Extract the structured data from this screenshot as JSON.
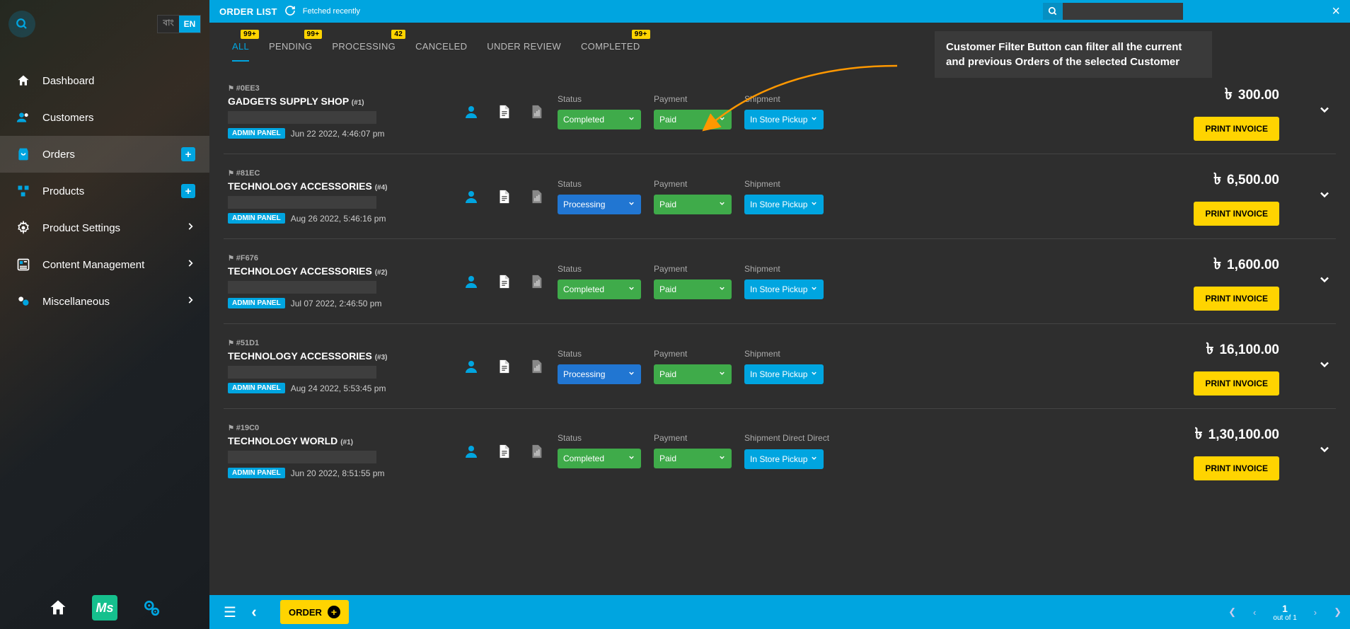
{
  "lang": {
    "bn": "বাং",
    "en": "EN"
  },
  "sidebar": {
    "items": [
      {
        "label": "Dashboard"
      },
      {
        "label": "Customers"
      },
      {
        "label": "Orders"
      },
      {
        "label": "Products"
      },
      {
        "label": "Product Settings"
      },
      {
        "label": "Content Management"
      },
      {
        "label": "Miscellaneous"
      }
    ]
  },
  "topbar": {
    "title": "ORDER LIST",
    "fetched": "Fetched recently"
  },
  "tabs": [
    {
      "label": "ALL",
      "badge": "99+"
    },
    {
      "label": "PENDING",
      "badge": "99+"
    },
    {
      "label": "PROCESSING",
      "badge": "42"
    },
    {
      "label": "CANCELED"
    },
    {
      "label": "UNDER REVIEW"
    },
    {
      "label": "COMPLETED",
      "badge": "99+"
    }
  ],
  "labels": {
    "status": "Status",
    "payment": "Payment",
    "shipment": "Shipment",
    "print": "PRINT INVOICE",
    "admin": "ADMIN PANEL"
  },
  "orders": [
    {
      "id": "#0EE3",
      "customer": "GADGETS SUPPLY SHOP",
      "num": "(#1)",
      "date": "Jun 22 2022, 4:46:07 pm",
      "status": "Completed",
      "statusClass": "green",
      "payment": "Paid",
      "shipment": "In Store Pickup",
      "shipExtra": "",
      "price": "300.00"
    },
    {
      "id": "#81EC",
      "customer": "TECHNOLOGY ACCESSORIES",
      "num": "(#4)",
      "date": "Aug 26 2022, 5:46:16 pm",
      "status": "Processing",
      "statusClass": "blue",
      "payment": "Paid",
      "shipment": "In Store Pickup",
      "shipExtra": "",
      "price": "6,500.00"
    },
    {
      "id": "#F676",
      "customer": "TECHNOLOGY ACCESSORIES",
      "num": "(#2)",
      "date": "Jul 07 2022, 2:46:50 pm",
      "status": "Completed",
      "statusClass": "green",
      "payment": "Paid",
      "shipment": "In Store Pickup",
      "shipExtra": "",
      "price": "1,600.00"
    },
    {
      "id": "#51D1",
      "customer": "TECHNOLOGY ACCESSORIES",
      "num": "(#3)",
      "date": "Aug 24 2022, 5:53:45 pm",
      "status": "Processing",
      "statusClass": "blue",
      "payment": "Paid",
      "shipment": "In Store Pickup",
      "shipExtra": "",
      "price": "16,100.00"
    },
    {
      "id": "#19C0",
      "customer": "TECHNOLOGY WORLD",
      "num": "(#1)",
      "date": "Jun 20 2022, 8:51:55 pm",
      "status": "Completed",
      "statusClass": "green",
      "payment": "Paid",
      "shipment": "In Store Pickup",
      "shipExtra": "Shipment Direct Direct",
      "price": "1,30,100.00"
    }
  ],
  "tooltip": "Customer Filter Button can filter all the current and previous Orders of the selected Customer",
  "footer": {
    "order": "ORDER",
    "page": "1",
    "outof": "out of 1"
  }
}
